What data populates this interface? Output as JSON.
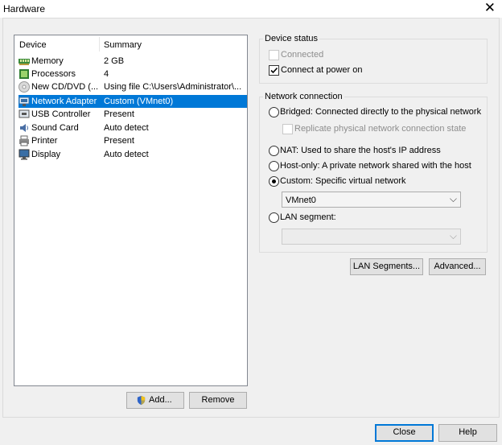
{
  "window": {
    "title": "Hardware",
    "close_glyph": "✕"
  },
  "device_list": {
    "columns": [
      "Device",
      "Summary"
    ],
    "rows": [
      {
        "device": "Memory",
        "summary": "2 GB",
        "icon": "memory-icon"
      },
      {
        "device": "Processors",
        "summary": "4",
        "icon": "processor-icon"
      },
      {
        "device": "New CD/DVD (...",
        "summary": "Using file C:\\Users\\Administrator\\...",
        "icon": "cd-dvd-icon"
      },
      {
        "device": "Network Adapter",
        "summary": "Custom (VMnet0)",
        "icon": "network-adapter-icon",
        "selected": true
      },
      {
        "device": "USB Controller",
        "summary": "Present",
        "icon": "usb-icon"
      },
      {
        "device": "Sound Card",
        "summary": "Auto detect",
        "icon": "speaker-icon"
      },
      {
        "device": "Printer",
        "summary": "Present",
        "icon": "printer-icon"
      },
      {
        "device": "Display",
        "summary": "Auto detect",
        "icon": "monitor-icon"
      }
    ]
  },
  "buttons": {
    "add": "Add...",
    "remove": "Remove",
    "lan_segments": "LAN Segments...",
    "advanced": "Advanced...",
    "close": "Close",
    "help": "Help"
  },
  "device_status": {
    "legend": "Device status",
    "connected": {
      "label": "Connected",
      "checked": false,
      "disabled": true
    },
    "connect_at_power_on": {
      "label": "Connect at power on",
      "checked": true
    }
  },
  "network_connection": {
    "legend": "Network connection",
    "bridged": "Bridged: Connected directly to the physical network",
    "replicate": "Replicate physical network connection state",
    "nat": "NAT: Used to share the host's IP address",
    "host_only": "Host-only: A private network shared with the host",
    "custom": "Custom: Specific virtual network",
    "custom_value": "VMnet0",
    "lan_segment": "LAN segment:",
    "lan_segment_value": "",
    "selected": "custom"
  },
  "colors": {
    "selection": "#0078d7",
    "accent_border": "#0078d7"
  }
}
